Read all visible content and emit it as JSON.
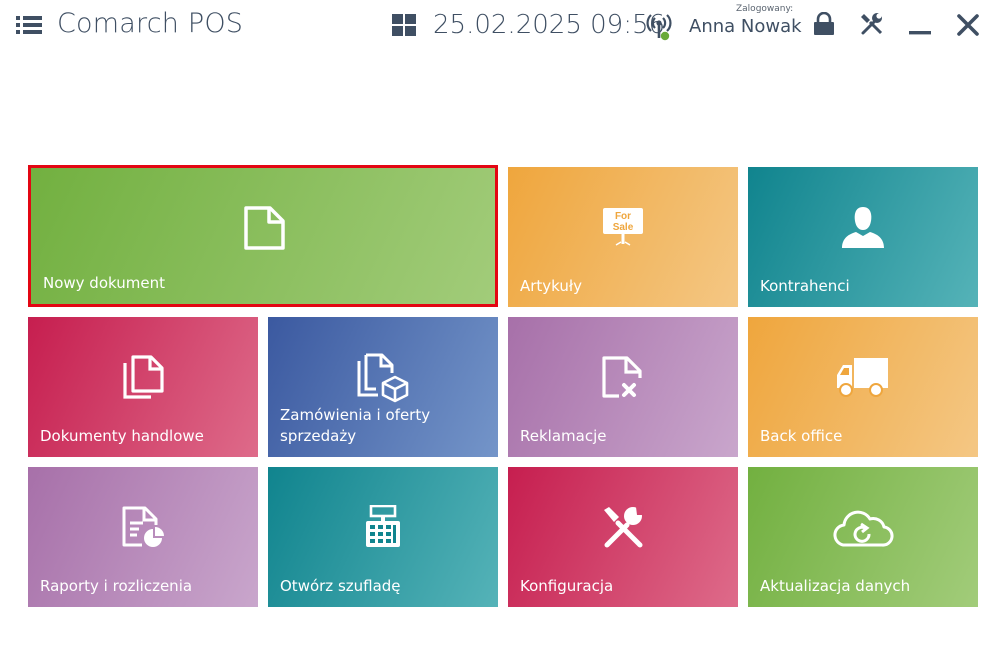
{
  "header": {
    "title": "Comarch POS",
    "datetime": "25.02.2025 09:56",
    "logged_label": "Zalogowany:",
    "user": "Anna Nowak",
    "icons": [
      "menu-icon",
      "grid-icon",
      "wifi-status-icon",
      "lock-icon",
      "tools-icon",
      "minimize-icon",
      "close-icon"
    ]
  },
  "colors": {
    "green": "#72b040",
    "orange": "#efa63d",
    "teal": "#10848e",
    "crimson": "#c61e4f",
    "blue": "#3b59a0",
    "purple": "#a770a9",
    "selection_border": "#e30613",
    "status_dot": "#6aaa3a"
  },
  "tiles": [
    {
      "label": "Nowy dokument",
      "icon": "document-icon",
      "selected": true
    },
    {
      "label": "Artykuły",
      "icon": "for-sale-sign-icon",
      "sign_line1": "For",
      "sign_line2": "Sale"
    },
    {
      "label": "Kontrahenci",
      "icon": "person-icon"
    },
    {
      "label": "Dokumenty handlowe",
      "icon": "documents-icon"
    },
    {
      "label": "Zamówienia i oferty sprzedaży",
      "icon": "order-box-icon"
    },
    {
      "label": "Reklamacje",
      "icon": "document-x-icon"
    },
    {
      "label": "Back office",
      "icon": "truck-icon"
    },
    {
      "label": "Raporty i rozliczenia",
      "icon": "report-icon"
    },
    {
      "label": "Otwórz szufladę",
      "icon": "cash-register-icon"
    },
    {
      "label": "Konfiguracja",
      "icon": "tools-icon"
    },
    {
      "label": "Aktualizacja danych",
      "icon": "cloud-sync-icon"
    }
  ]
}
